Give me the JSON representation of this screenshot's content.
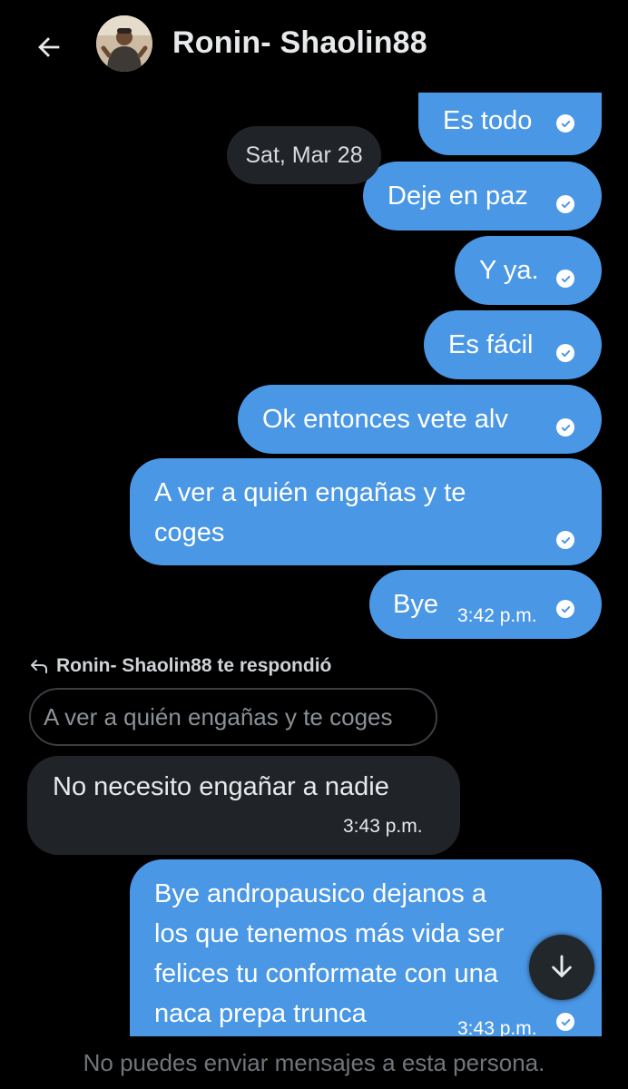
{
  "header": {
    "title": "Ronin- Shaolin88"
  },
  "thread": {
    "date_separator": "Sat, Mar 28",
    "outgoing": [
      {
        "text": "Es todo"
      },
      {
        "text": "Deje en paz"
      },
      {
        "text": "Y ya."
      },
      {
        "text": "Es fácil"
      },
      {
        "text": "Ok entonces vete alv"
      },
      {
        "text": "A ver a quién engañas y te coges"
      },
      {
        "text": "Bye",
        "time": "3:42 p.m."
      }
    ],
    "reply_notice": "Ronin- Shaolin88 te respondió",
    "quoted_text": "A ver a quién engañas y te coges",
    "incoming": {
      "text": "No necesito engañar a nadie",
      "time": "3:43 p.m."
    },
    "last_outgoing": {
      "text": "Bye andropausico dejanos a los que tenemos más vida ser felices tu conformate con una naca prepa trunca",
      "lines": [
        "Bye andropausico dejanos a",
        "los que tenemos más vida ser",
        "felices tu conformate con una",
        "naca prepa trunca"
      ],
      "time": "3:43 p.m."
    }
  },
  "footer": {
    "notice": "No puedes enviar mensajes a esta persona."
  },
  "colors": {
    "background": "#000000",
    "outgoing_bubble": "#4a97e6",
    "incoming_bubble": "#202327",
    "secondary_text": "#71767b"
  },
  "icons": [
    "back-arrow-icon",
    "read-check-icon",
    "reply-arrow-icon",
    "arrow-down-icon"
  ]
}
